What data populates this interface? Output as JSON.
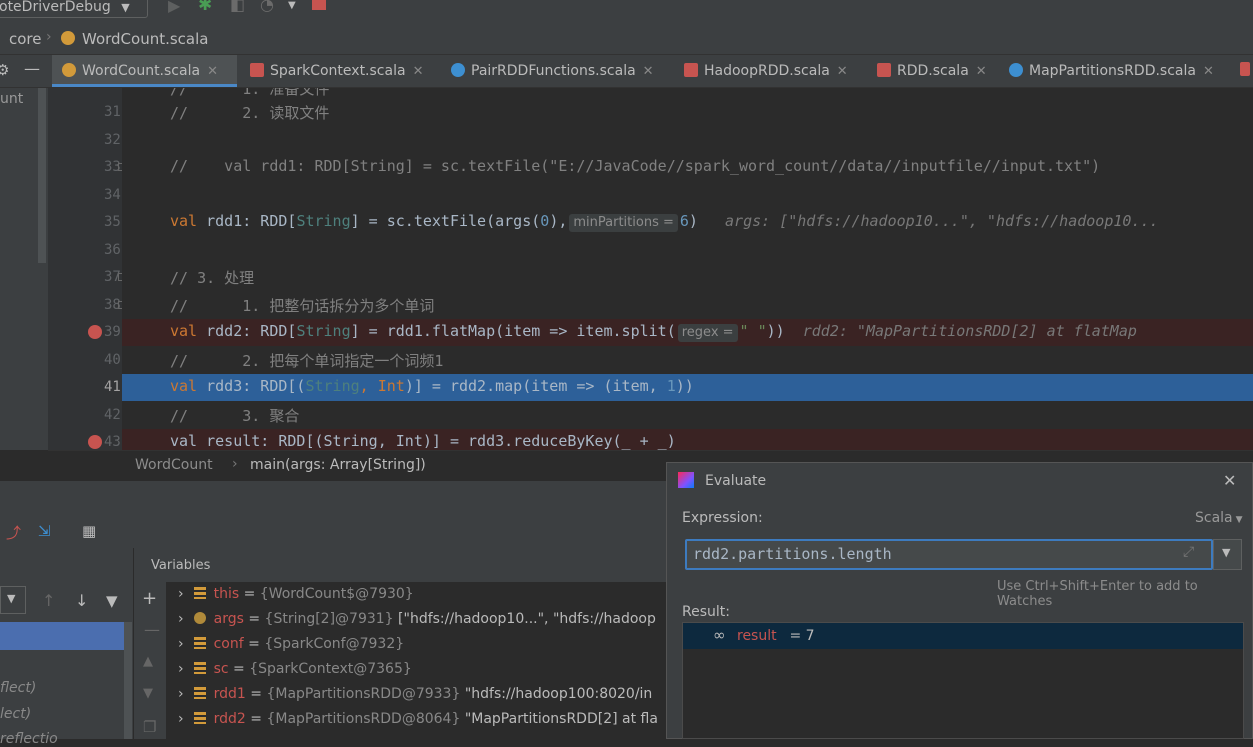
{
  "toolbar": {
    "run_config": "oteDriverDebug"
  },
  "breadcrumb": {
    "module": "core",
    "file": "WordCount.scala"
  },
  "tabs": [
    {
      "label": "WordCount.scala",
      "active": true
    },
    {
      "label": "SparkContext.scala",
      "active": false
    },
    {
      "label": "PairRDDFunctions.scala",
      "active": false
    },
    {
      "label": "HadoopRDD.scala",
      "active": false
    },
    {
      "label": "RDD.scala",
      "active": false
    },
    {
      "label": "MapPartitionsRDD.scala",
      "active": false
    }
  ],
  "side_label": "unt",
  "editor": {
    "lines": {
      "l31": "31",
      "l32": "32",
      "l33": "33",
      "l34": "34",
      "l35": "35",
      "l36": "36",
      "l37": "37",
      "l38": "38",
      "l39": "39",
      "l40": "40",
      "l41": "41",
      "l42": "42",
      "l43": "43"
    },
    "c31": "//      2. 读取文件",
    "c33": "//    val rdd1: RDD[String] = sc.textFile(\"E://JavaCode//spark_word_count//data//inputfile//input.txt\")",
    "c35_a": "val",
    "c35_b": " rdd1: RDD[",
    "c35_c": "String",
    "c35_d": "] = sc.textFile(args(",
    "c35_e": "0",
    "c35_f": "),",
    "c35_hint": "minPartitions =",
    "c35_g": "6",
    "c35_h": ")",
    "c35_inline": "args: [\"hdfs://hadoop10...\", \"hdfs://hadoop10...",
    "c37": "// 3. 处理",
    "c38": "//      1. 把整句话拆分为多个单词",
    "c39_a": "val",
    "c39_b": " rdd2: RDD[",
    "c39_c": "String",
    "c39_d": "] = rdd1.flatMap(item => item.split(",
    "c39_hint": "regex =",
    "c39_e": "\" \"",
    "c39_f": "))",
    "c39_inline": "rdd2: \"MapPartitionsRDD[2] at flatMap",
    "c40": "//      2. 把每个单词指定一个词频1",
    "c41_a": "val",
    "c41_b": " rdd3: RDD[(",
    "c41_c": "String",
    "c41_d": ", ",
    "c41_e": "Int",
    "c41_f": ")] = rdd2.map(item => (item, ",
    "c41_g": "1",
    "c41_h": "))",
    "c42": "//      3. 聚合",
    "c43": "val result: RDD[(String, Int)] = rdd3.reduceByKey(_ + _)"
  },
  "editor_breadcrumb": {
    "object": "WordCount",
    "method": "main(args: Array[String])"
  },
  "debug": {
    "variables_title": "Variables",
    "frames": [
      "flect)",
      "lect)",
      "reflectio"
    ],
    "variables": [
      {
        "name": "this",
        "eq": " = ",
        "type": "{WordCount$@7930}",
        "value": ""
      },
      {
        "name": "args",
        "eq": " = ",
        "type": "{String[2]@7931}",
        "value": " [\"hdfs://hadoop10...\", \"hdfs://hadoop"
      },
      {
        "name": "conf",
        "eq": " = ",
        "type": "{SparkConf@7932}",
        "value": ""
      },
      {
        "name": "sc",
        "eq": " = ",
        "type": "{SparkContext@7365}",
        "value": ""
      },
      {
        "name": "rdd1",
        "eq": " = ",
        "type": "{MapPartitionsRDD@7933}",
        "value": " \"hdfs://hadoop100:8020/in"
      },
      {
        "name": "rdd2",
        "eq": " = ",
        "type": "{MapPartitionsRDD@8064}",
        "value": " \"MapPartitionsRDD[2] at fla"
      }
    ]
  },
  "evaluate": {
    "title": "Evaluate",
    "expression_label": "Expression:",
    "language": "Scala",
    "expression": "rdd2.partitions.length",
    "watch_hint": "Use Ctrl+Shift+Enter to add to Watches",
    "result_label": "Result:",
    "result_name": "result",
    "result_eq": " = ",
    "result_value": "7"
  },
  "colors": {
    "accent": "#4a88c7",
    "breakpoint": "#c75450",
    "current_line": "#2d6099",
    "keyword": "#cc7832"
  }
}
